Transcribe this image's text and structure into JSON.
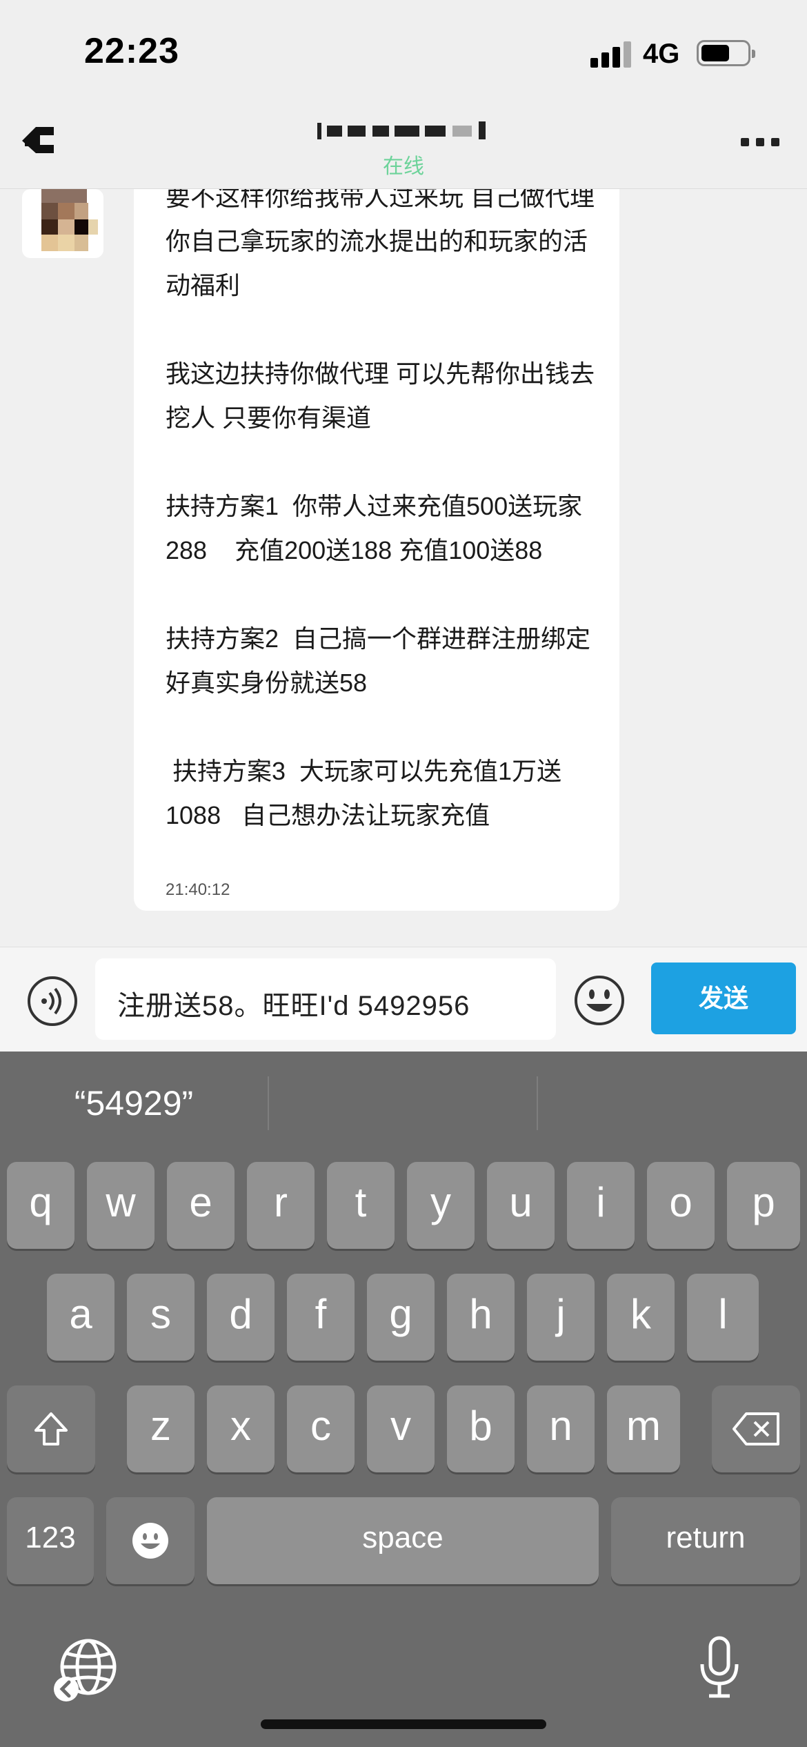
{
  "status_bar": {
    "time": "22:23",
    "carrier": "4G"
  },
  "nav": {
    "presence": "在线"
  },
  "message": {
    "paragraphs": [
      "要不这样你给我带人过来玩 自己做代理\n你自己拿玩家的流水提出的和玩家的活\n动福利",
      "我这边扶持你做代理 可以先帮你出钱去\n挖人 只要你有渠道",
      "扶持方案1  你带人过来充值500送玩家\n288    充值200送188 充值100送88",
      "扶持方案2  自己搞一个群进群注册绑定\n好真实身份就送58",
      " 扶持方案3  大玩家可以先充值1万送\n1088   自己想办法让玩家充值"
    ],
    "timestamp": "21:40:12"
  },
  "composer": {
    "value": "注册送58。旺旺I'd 5492956",
    "send_label": "发送"
  },
  "keyboard": {
    "suggestions": [
      "“54929”",
      "",
      ""
    ],
    "row1": [
      "q",
      "w",
      "e",
      "r",
      "t",
      "y",
      "u",
      "i",
      "o",
      "p"
    ],
    "row2": [
      "a",
      "s",
      "d",
      "f",
      "g",
      "h",
      "j",
      "k",
      "l"
    ],
    "row3": [
      "z",
      "x",
      "c",
      "v",
      "b",
      "n",
      "m"
    ],
    "numbers_label": "123",
    "space_label": "space",
    "return_label": "return"
  },
  "icons": {
    "back": "back-arrow-icon",
    "more": "more-icon",
    "voice": "voice-icon",
    "emoji": "emoji-icon",
    "shift": "shift-icon",
    "delete": "delete-icon",
    "globe": "globe-icon",
    "mic": "mic-icon"
  },
  "colors": {
    "accent": "#1da1e2",
    "presence": "#6dd39a",
    "keyboard_bg": "#6b6b6b",
    "key_bg": "#929292"
  }
}
